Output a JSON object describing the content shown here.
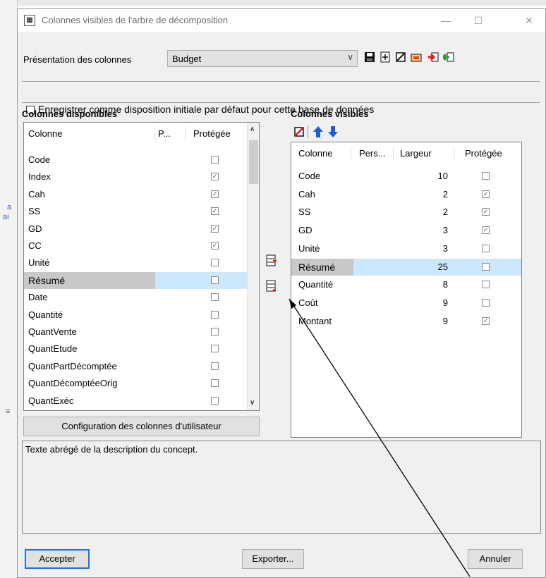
{
  "dialog": {
    "title": "Colonnes visibles de l'arbre de décomposition",
    "minimize_glyph": "—",
    "maximize_glyph": "☐",
    "close_glyph": "✕"
  },
  "presentation": {
    "label": "Présentation des colonnes",
    "value": "Budget",
    "toolbar_icons": [
      "save-icon",
      "add-icon",
      "clear-icon",
      "open-icon",
      "import-red-icon",
      "export-green-icon"
    ]
  },
  "save_default": {
    "label": "Enregistrer comme disposition initiale par défaut pour cette base de données",
    "checked": false
  },
  "available": {
    "title": "Colonnes disponibles",
    "columns": [
      "Colonne",
      "P...",
      "Protégée"
    ],
    "rows": [
      {
        "name": "Code",
        "p": "",
        "protected": false
      },
      {
        "name": "Index",
        "p": "",
        "protected": true
      },
      {
        "name": "Cah",
        "p": "",
        "protected": true
      },
      {
        "name": "SS",
        "p": "",
        "protected": true
      },
      {
        "name": "GD",
        "p": "",
        "protected": true
      },
      {
        "name": "CC",
        "p": "",
        "protected": true
      },
      {
        "name": "Unité",
        "p": "",
        "protected": false
      },
      {
        "name": "Résumé",
        "p": "",
        "protected": false,
        "selected": true
      },
      {
        "name": "Date",
        "p": "",
        "protected": false
      },
      {
        "name": "Quantité",
        "p": "",
        "protected": false
      },
      {
        "name": "QuantVente",
        "p": "",
        "protected": false
      },
      {
        "name": "QuantEtude",
        "p": "",
        "protected": false
      },
      {
        "name": "QuantPartDécomptée",
        "p": "",
        "protected": false
      },
      {
        "name": "QuantDécomptéeOrig",
        "p": "",
        "protected": false
      },
      {
        "name": "QuantExéc",
        "p": "",
        "protected": false
      }
    ],
    "user_config_button": "Configuration des colonnes d'utilisateur"
  },
  "visible": {
    "title": "Colonnes visibles",
    "toolbar_icons": [
      "clear-red-icon",
      "arrow-up-icon",
      "arrow-down-icon"
    ],
    "columns": [
      "Colonne",
      "Pers...",
      "Largeur",
      "Protégée"
    ],
    "rows": [
      {
        "name": "Code",
        "pers": "",
        "width": "10",
        "protected": false
      },
      {
        "name": "Cah",
        "pers": "",
        "width": "2",
        "protected": true
      },
      {
        "name": "SS",
        "pers": "",
        "width": "2",
        "protected": true
      },
      {
        "name": "GD",
        "pers": "",
        "width": "3",
        "protected": true
      },
      {
        "name": "Unité",
        "pers": "",
        "width": "3",
        "protected": false
      },
      {
        "name": "Résumé",
        "pers": "",
        "width": "25",
        "protected": false,
        "selected": true
      },
      {
        "name": "Quantité",
        "pers": "",
        "width": "8",
        "protected": false
      },
      {
        "name": "Coût",
        "pers": "",
        "width": "9",
        "protected": false
      },
      {
        "name": "Montant",
        "pers": "",
        "width": "9",
        "protected": true
      }
    ]
  },
  "transfer_icons": [
    "add-column-icon",
    "remove-column-icon"
  ],
  "description": "Texte abrégé de la description du concept.",
  "buttons": {
    "accept": "Accepter",
    "export": "Exporter...",
    "cancel": "Annuler"
  },
  "background": {
    "help_glyph": "?",
    "marks": [
      "a",
      "ai",
      "≡"
    ]
  },
  "colors": {
    "selection_gray": "#c8c8c8",
    "selection_blue": "#cce8ff",
    "accent_blue": "#1e73d8"
  }
}
